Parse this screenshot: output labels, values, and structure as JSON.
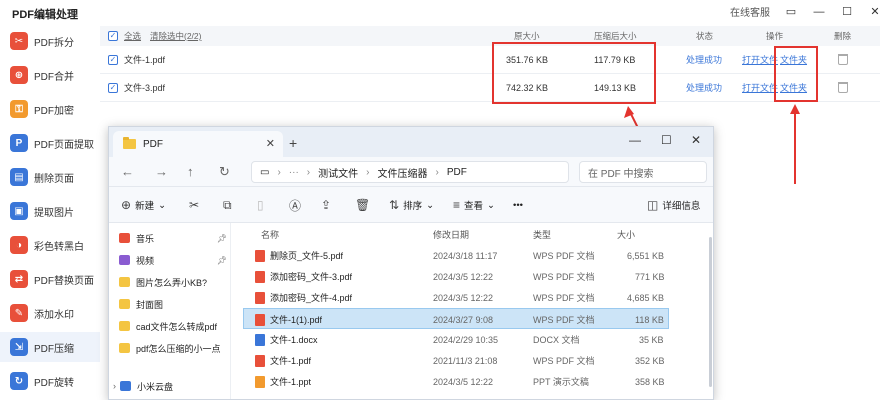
{
  "app": {
    "title": "PDF编辑处理",
    "service": "在线客服",
    "minimize": "▭",
    "restore": "—",
    "maximize": "☐",
    "close": "✕"
  },
  "sidebar": {
    "items": [
      {
        "label": "PDF拆分",
        "icon": "split-icon",
        "color": "#e8503a"
      },
      {
        "label": "PDF合并",
        "icon": "merge-icon",
        "color": "#e8503a"
      },
      {
        "label": "PDF加密",
        "icon": "lock-icon",
        "color": "#f29a2e"
      },
      {
        "label": "PDF页面提取",
        "icon": "extract-page-icon",
        "color": "#3a76d8"
      },
      {
        "label": "删除页面",
        "icon": "delete-page-icon",
        "color": "#3a76d8"
      },
      {
        "label": "提取图片",
        "icon": "image-icon",
        "color": "#3a76d8"
      },
      {
        "label": "彩色转黑白",
        "icon": "color-icon",
        "color": "#e8503a"
      },
      {
        "label": "PDF替换页面",
        "icon": "replace-icon",
        "color": "#e8503a"
      },
      {
        "label": "添加水印",
        "icon": "watermark-icon",
        "color": "#e8503a"
      },
      {
        "label": "PDF压缩",
        "icon": "compress-icon",
        "color": "#3a76d8"
      },
      {
        "label": "PDF旋转",
        "icon": "rotate-icon",
        "color": "#3a76d8"
      }
    ],
    "active_index": 9
  },
  "table": {
    "select_all": "全选",
    "clear_selected": "清除选中(2/2)",
    "col_original": "原大小",
    "col_compressed": "压缩后大小",
    "col_status": "状态",
    "col_action": "操作",
    "col_delete": "删除",
    "rows": [
      {
        "name": "文件-1.pdf",
        "original": "351.76 KB",
        "compressed": "117.79 KB",
        "status": "处理成功",
        "open_file": "打开文件",
        "folder": "文件夹"
      },
      {
        "name": "文件-3.pdf",
        "original": "742.32 KB",
        "compressed": "149.13 KB",
        "status": "处理成功",
        "open_file": "打开文件",
        "folder": "文件夹"
      }
    ]
  },
  "explorer": {
    "tab_title": "PDF",
    "tab_close": "✕",
    "new_tab": "+",
    "address": {
      "seg1": "测试文件",
      "seg2": "文件压缩器",
      "seg3": "PDF"
    },
    "search_placeholder": "在 PDF 中搜索",
    "toolbar": {
      "new": "新建",
      "sort": "排序",
      "view": "查看",
      "more": "•••",
      "details": "详细信息"
    },
    "nav": [
      {
        "label": "音乐",
        "color": "#e8503a"
      },
      {
        "label": "视频",
        "color": "#8a5cd1"
      },
      {
        "label": "图片怎么弄小KB?",
        "color": "#f4c542"
      },
      {
        "label": "封面图",
        "color": "#f4c542"
      },
      {
        "label": "cad文件怎么转成pdf",
        "color": "#f4c542"
      },
      {
        "label": "pdf怎么压缩的小一点",
        "color": "#f4c542"
      },
      {
        "label": "小米云盘",
        "color": "#3a76d8"
      }
    ],
    "columns": {
      "name": "名称",
      "modified": "修改日期",
      "type": "类型",
      "size": "大小"
    },
    "files": [
      {
        "name": "删除页_文件-5.pdf",
        "modified": "2024/3/18 11:17",
        "type": "WPS PDF 文档",
        "size": "6,551 KB",
        "color": "#e8503a"
      },
      {
        "name": "添加密码_文件-3.pdf",
        "modified": "2024/3/5 12:22",
        "type": "WPS PDF 文档",
        "size": "771 KB",
        "color": "#e8503a"
      },
      {
        "name": "添加密码_文件-4.pdf",
        "modified": "2024/3/5 12:22",
        "type": "WPS PDF 文档",
        "size": "4,685 KB",
        "color": "#e8503a"
      },
      {
        "name": "文件-1(1).pdf",
        "modified": "2024/3/27 9:08",
        "type": "WPS PDF 文档",
        "size": "118 KB",
        "color": "#e8503a"
      },
      {
        "name": "文件-1.docx",
        "modified": "2024/2/29 10:35",
        "type": "DOCX 文档",
        "size": "35 KB",
        "color": "#3a76d8"
      },
      {
        "name": "文件-1.pdf",
        "modified": "2021/11/3 21:08",
        "type": "WPS PDF 文档",
        "size": "352 KB",
        "color": "#e8503a"
      },
      {
        "name": "文件-1.ppt",
        "modified": "2024/3/5 12:22",
        "type": "PPT 演示文稿",
        "size": "358 KB",
        "color": "#f29a2e"
      }
    ],
    "selected_index": 3
  },
  "colors": {
    "accent": "#3a76d8",
    "annotation": "#e3342f"
  }
}
